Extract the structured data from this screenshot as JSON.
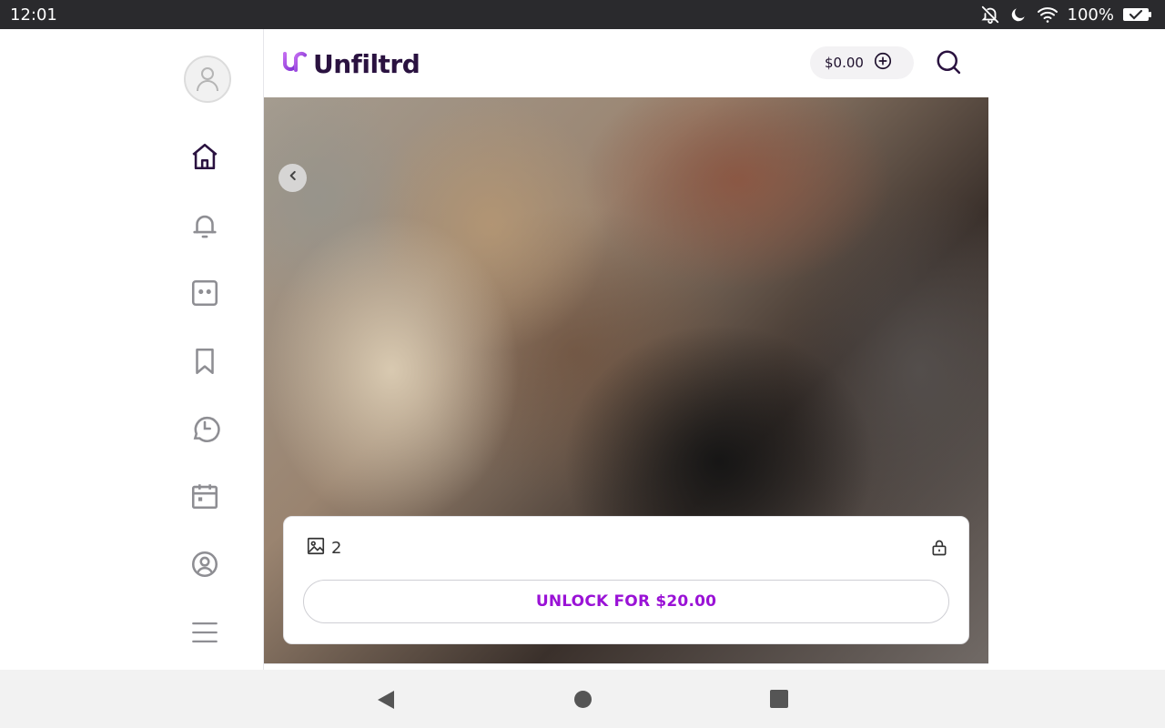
{
  "status_bar": {
    "time": "12:01",
    "battery": "100%"
  },
  "header": {
    "logo_text": "Unfiltrd",
    "wallet_balance": "$0.00"
  },
  "sidebar": {
    "items": [
      {
        "name": "home",
        "icon": "home-icon",
        "active": true
      },
      {
        "name": "notifications",
        "icon": "bell-icon"
      },
      {
        "name": "messages",
        "icon": "chat-icon"
      },
      {
        "name": "bookmarks",
        "icon": "bookmark-icon"
      },
      {
        "name": "history",
        "icon": "history-icon"
      },
      {
        "name": "calendar",
        "icon": "calendar-icon"
      },
      {
        "name": "profile",
        "icon": "user-circle-icon"
      },
      {
        "name": "menu",
        "icon": "menu-icon"
      }
    ]
  },
  "post": {
    "image_count": "2",
    "unlock_label": "UNLOCK FOR $20.00"
  },
  "colors": {
    "accent": "#9a12d6",
    "brand_dark": "#2a1240",
    "logo_gradient_start": "#c36cf0",
    "logo_gradient_end": "#7b2ed0"
  }
}
